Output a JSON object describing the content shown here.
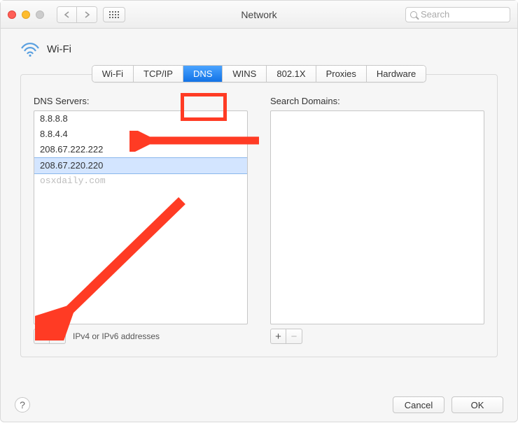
{
  "window": {
    "title": "Network",
    "search_placeholder": "Search"
  },
  "header": {
    "interface_name": "Wi-Fi"
  },
  "tabs": [
    {
      "label": "Wi-Fi",
      "active": false
    },
    {
      "label": "TCP/IP",
      "active": false
    },
    {
      "label": "DNS",
      "active": true
    },
    {
      "label": "WINS",
      "active": false
    },
    {
      "label": "802.1X",
      "active": false
    },
    {
      "label": "Proxies",
      "active": false
    },
    {
      "label": "Hardware",
      "active": false
    }
  ],
  "dns": {
    "servers_label": "DNS Servers:",
    "domains_label": "Search Domains:",
    "servers": [
      {
        "value": "8.8.8.8",
        "selected": false
      },
      {
        "value": "8.8.4.4",
        "selected": false
      },
      {
        "value": "208.67.222.222",
        "selected": false
      },
      {
        "value": "208.67.220.220",
        "selected": true
      }
    ],
    "watermark": "osxdaily.com",
    "hint": "IPv4 or IPv6 addresses",
    "domains": []
  },
  "buttons": {
    "cancel": "Cancel",
    "ok": "OK",
    "plus": "+",
    "minus": "−",
    "help": "?"
  },
  "annotations": {
    "highlight_tab": "DNS",
    "arrow_to_selected_row": true,
    "arrow_to_plus_button": true
  },
  "colors": {
    "annotation_red": "#ff3b24",
    "selection_blue": "#d3e5ff",
    "tab_active_blue": "#1273e6"
  }
}
